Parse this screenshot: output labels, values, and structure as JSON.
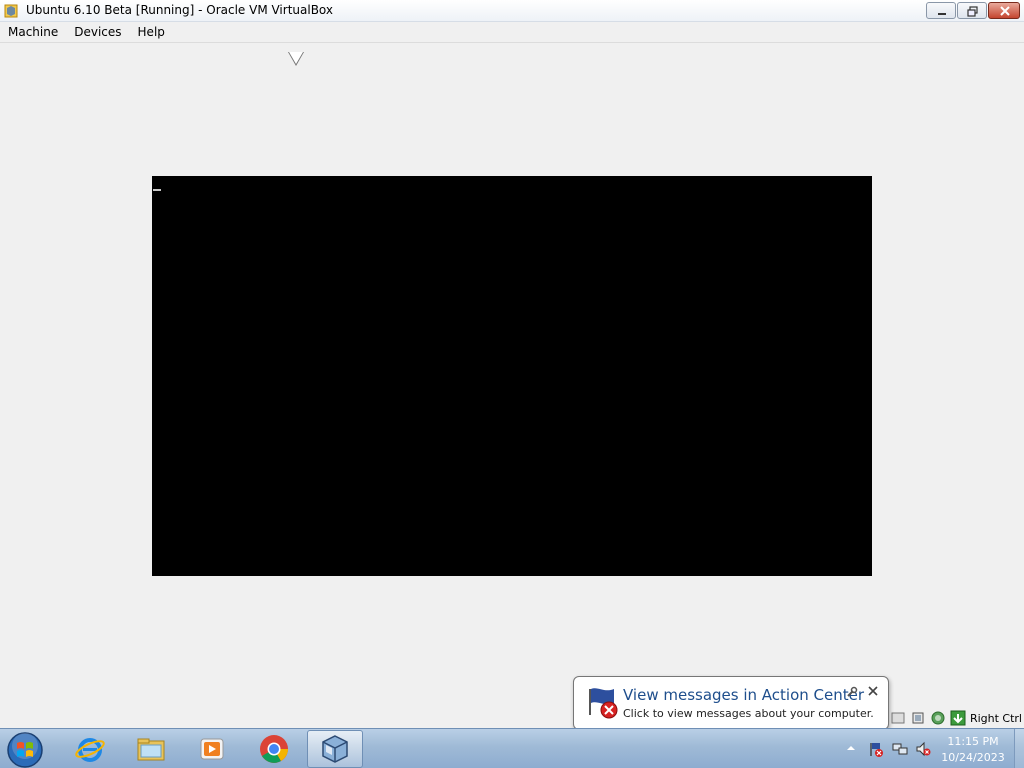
{
  "window": {
    "title": "Ubuntu 6.10 Beta [Running] - Oracle VM VirtualBox",
    "app_icon": "virtualbox-icon",
    "buttons": {
      "minimize": "minimize-icon",
      "maximize": "restore-icon",
      "close": "close-icon"
    }
  },
  "menubar": {
    "items": [
      {
        "label": "Machine"
      },
      {
        "label": "Devices"
      },
      {
        "label": "Help"
      }
    ]
  },
  "vm_screen": {
    "background": "#000000",
    "cursor": "text-cursor"
  },
  "vbox_status": {
    "icons": [
      "storage-icon",
      "cpu-icon",
      "network-icon",
      "host-key-icon"
    ],
    "host_key_label": "Right Ctrl"
  },
  "balloon": {
    "title": "View messages in Action Center",
    "body": "Click to view messages about your computer.",
    "icon": "action-center-flag-icon",
    "title_color": "#1e4e8c"
  },
  "taskbar": {
    "start_icon": "windows-start-icon",
    "apps": [
      {
        "name": "internet-explorer-icon",
        "active": false
      },
      {
        "name": "file-explorer-icon",
        "active": false
      },
      {
        "name": "media-player-icon",
        "active": false
      },
      {
        "name": "chrome-icon",
        "active": false
      },
      {
        "name": "virtualbox-icon",
        "active": true
      }
    ],
    "tray_icons": [
      "show-hidden-icons-arrow",
      "action-center-flag-icon",
      "network-icon",
      "volume-muted-icon"
    ],
    "time": "11:15 PM",
    "date": "10/24/2023"
  }
}
